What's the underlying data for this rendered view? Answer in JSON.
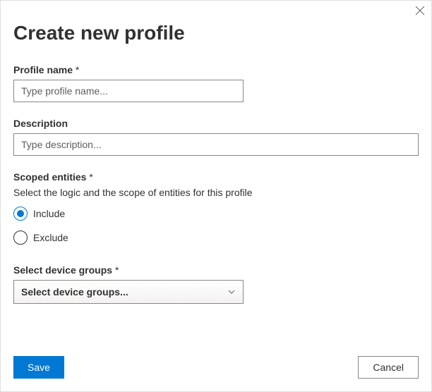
{
  "dialog": {
    "title": "Create new profile",
    "fields": {
      "profile_name": {
        "label": "Profile name",
        "placeholder": "Type profile name...",
        "value": ""
      },
      "description": {
        "label": "Description",
        "placeholder": "Type description...",
        "value": ""
      },
      "scoped_entities": {
        "label": "Scoped entities",
        "help_text": "Select the logic and the scope of entities for this profile",
        "options": {
          "include": "Include",
          "exclude": "Exclude"
        },
        "selected": "include"
      },
      "device_groups": {
        "label": "Select device groups",
        "placeholder": "Select device groups..."
      }
    },
    "buttons": {
      "save": "Save",
      "cancel": "Cancel"
    }
  }
}
